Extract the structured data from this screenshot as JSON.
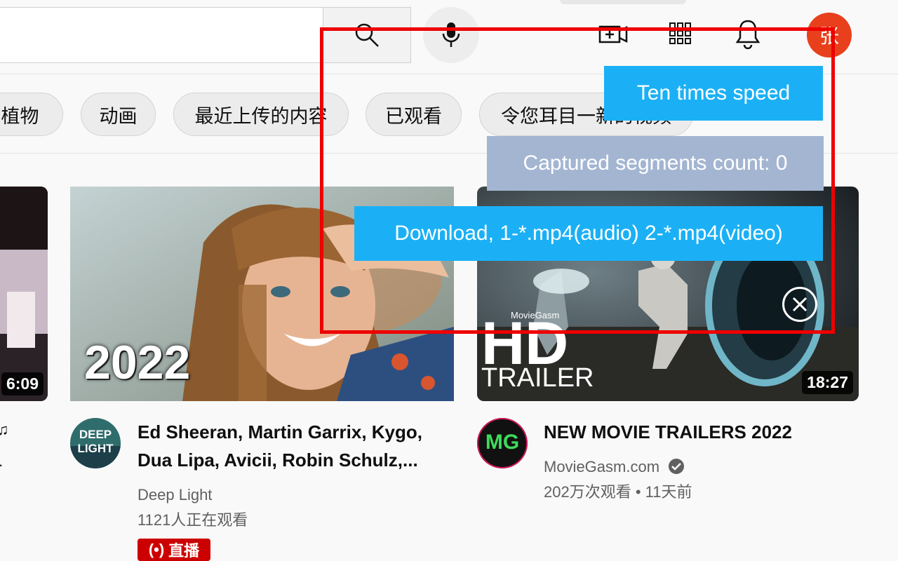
{
  "header": {
    "search_placeholder": "",
    "avatar_letter": "张"
  },
  "chips": [
    "动植物",
    "动画",
    "最近上传的内容",
    "已观看",
    "令您耳目一新的视频"
  ],
  "videos": [
    {
      "duration": "6:09"
    },
    {
      "thumb_text": "2022",
      "title_line1": "Ed Sheeran, Martin Garrix, Kygo,",
      "title_line2": "Dua Lipa, Avicii, Robin Schulz,...",
      "channel": "Deep Light",
      "channel_avatar_line1": "DEEP",
      "channel_avatar_line2": "LIGHT",
      "stats": "1121人正在观看",
      "live_label": "直播"
    },
    {
      "thumb_brand": "MovieGasm",
      "thumb_hd": "HD",
      "thumb_trailer": "TRAILER",
      "duration": "18:27",
      "title": "NEW MOVIE TRAILERS 2022",
      "channel": "MovieGasm.com",
      "channel_avatar_text": "MG",
      "stats": "202万次观看 • 11天前"
    }
  ],
  "extension": {
    "speed_label": "Ten times speed",
    "count_label": "Captured segments count: 0",
    "download_label": "Download, 1-*.mp4(audio) 2-*.mp4(video)"
  },
  "colors": {
    "accent": "#1bb0f5",
    "muted_panel": "#a3b5d1",
    "frame": "#ee0000",
    "live": "#cc0000",
    "avatar": "#e8401c"
  }
}
